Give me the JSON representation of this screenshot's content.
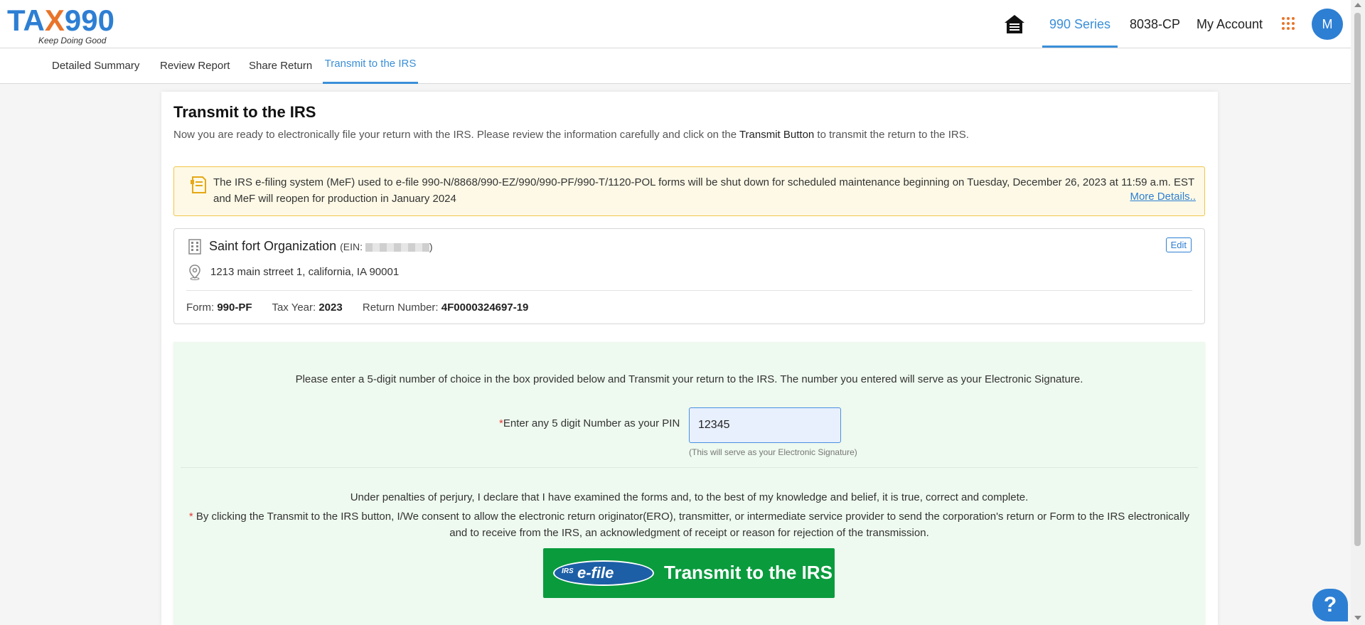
{
  "header": {
    "logo_text_a": "TA",
    "logo_text_x": "X",
    "logo_text_b": "990",
    "logo_tagline": "Keep Doing Good",
    "nav": [
      {
        "label": "990 Series",
        "active": true
      },
      {
        "label": "8038-CP",
        "active": false
      },
      {
        "label": "My Account",
        "active": false
      }
    ],
    "avatar_initial": "M"
  },
  "subnav": [
    {
      "label": "Detailed Summary"
    },
    {
      "label": "Review Report"
    },
    {
      "label": "Share Return"
    },
    {
      "label": "Transmit to the IRS",
      "active": true
    }
  ],
  "page": {
    "title": "Transmit to the IRS",
    "subtitle_pre": "Now you are ready to electronically file your return with the IRS. Please review the information carefully and click on the ",
    "subtitle_bold": "Transmit Button",
    "subtitle_post": " to transmit the return to the IRS."
  },
  "notice": {
    "text": "The IRS e-filing system (MeF) used to e-file 990-N/8868/990-EZ/990/990-PF/990-T/1120-POL forms will be shut down for scheduled maintenance beginning on Tuesday, December 26, 2023 at 11:59 a.m. EST and MeF will reopen for production in January 2024",
    "link": "More Details.."
  },
  "organization": {
    "name": "Saint fort Organization",
    "ein_prefix": "(EIN: ",
    "ein_suffix": ")",
    "edit_label": "Edit",
    "address": "1213 main strreet 1, california, IA 90001",
    "form_label": "Form:",
    "form_value": "990-PF",
    "tax_year_label": "Tax Year:",
    "tax_year_value": "2023",
    "return_number_label": "Return Number:",
    "return_number_value": "4F0000324697-19"
  },
  "signature": {
    "intro": "Please enter a 5-digit number of choice in the box provided below and Transmit your return to the IRS. The number you entered will serve as your Electronic Signature.",
    "pin_required_mark": "*",
    "pin_label": "Enter any 5 digit Number as your PIN",
    "pin_value": "12345",
    "pin_hint": "(This will serve as your Electronic Signature)",
    "perjury": "Under penalties of perjury, I declare that I have examined the forms and, to the best of my knowledge and belief, it is true, correct and complete.",
    "consent_mark": "*",
    "consent": "By clicking the Transmit to the IRS button, I/We consent to allow the electronic return originator(ERO), transmitter, or intermediate service provider to send the corporation's return or Form to the IRS electronically and to receive from the IRS, an acknowledgment of receipt or reason for rejection of the transmission.",
    "efile_irs": "IRS",
    "efile_logo": "e-file",
    "transmit_label": "Transmit to the IRS"
  },
  "help": {
    "label": "?"
  },
  "colors": {
    "brand_blue": "#2d7fd3",
    "brand_orange": "#e8742a",
    "notice_bg": "#fdf9e6",
    "notice_border": "#f0c64a",
    "signature_bg": "#eef9ef",
    "transmit_green": "#0a9b3d",
    "required_red": "#e53935"
  },
  "icons": [
    "home-icon",
    "apps-grid-icon",
    "maintenance-notice-icon",
    "building-icon",
    "location-pin-icon",
    "help-icon"
  ]
}
